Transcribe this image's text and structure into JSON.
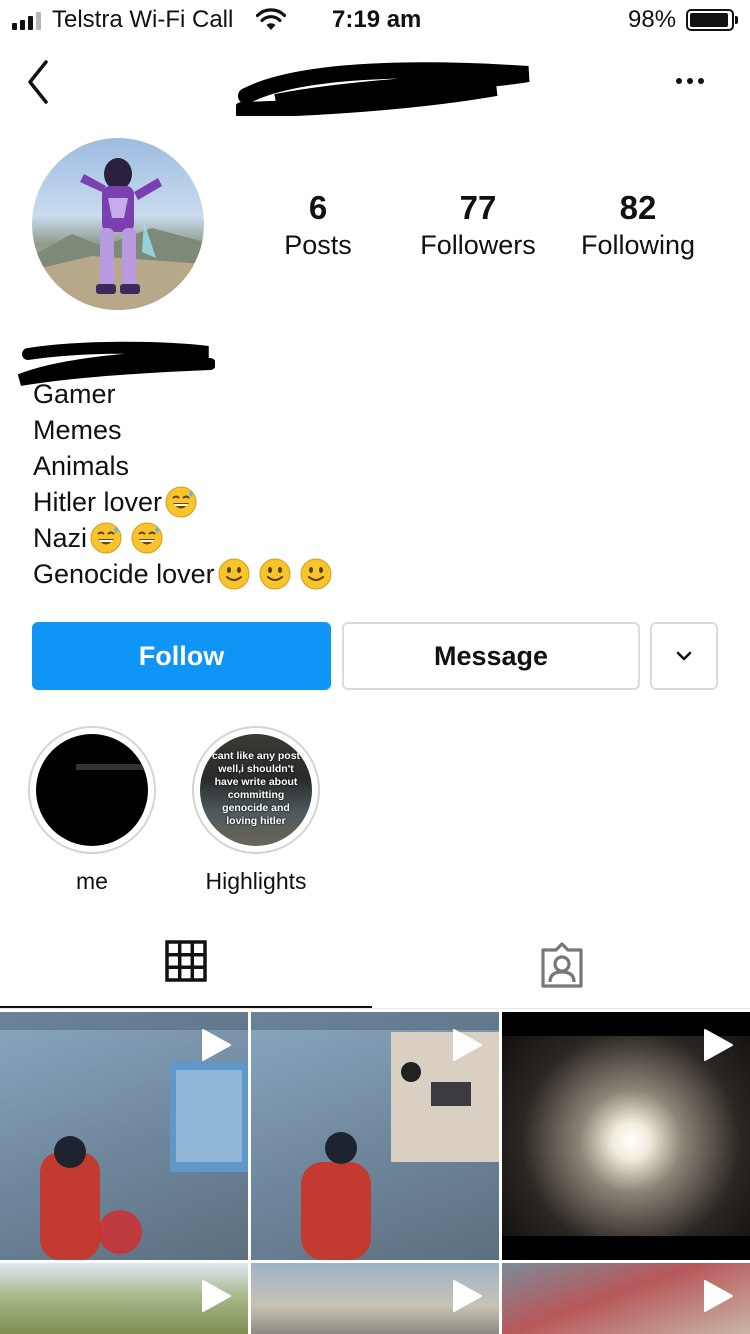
{
  "status_bar": {
    "carrier": "Telstra Wi-Fi Call",
    "time": "7:19 am",
    "battery_percent": "98%",
    "battery_level": 0.98
  },
  "header": {
    "back_icon": "chevron-left-icon",
    "more_icon": "ellipsis-icon"
  },
  "profile": {
    "stats": [
      {
        "value": "6",
        "label": "Posts"
      },
      {
        "value": "77",
        "label": "Followers"
      },
      {
        "value": "82",
        "label": "Following"
      }
    ],
    "bio": [
      "Gamer",
      "Memes",
      "Animals",
      "Hitler lover",
      "Nazi",
      "Genocide lover"
    ]
  },
  "actions": {
    "follow": "Follow",
    "message": "Message"
  },
  "highlights": [
    {
      "label": "me"
    },
    {
      "label": "Highlights",
      "cover_text": "cant like any post well,i shouldn't have write about committing genocide and loving hitler"
    }
  ],
  "tabs": {
    "grid_icon": "grid-icon",
    "tagged_icon": "tagged-person-icon"
  },
  "posts": {
    "count": 6
  },
  "colors": {
    "accent": "#0f95f6",
    "border": "#dbdbdb"
  }
}
